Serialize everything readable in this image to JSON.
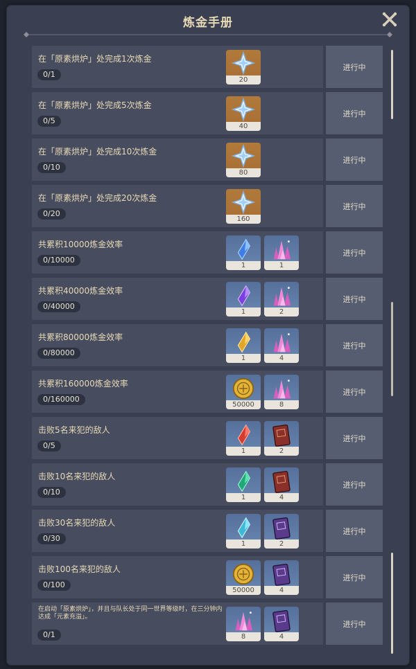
{
  "title": "炼金手册",
  "rows": [
    {
      "text": "在「原素烘炉」处完成1次炼金",
      "progress": "0/1",
      "status": "进行中",
      "rewards": [
        {
          "icon": "primogem-icon",
          "qty": "20",
          "bg": "gold"
        }
      ]
    },
    {
      "text": "在「原素烘炉」处完成5次炼金",
      "progress": "0/5",
      "status": "进行中",
      "rewards": [
        {
          "icon": "primogem-icon",
          "qty": "40",
          "bg": "gold"
        }
      ]
    },
    {
      "text": "在「原素烘炉」处完成10次炼金",
      "progress": "0/10",
      "status": "进行中",
      "rewards": [
        {
          "icon": "primogem-icon",
          "qty": "80",
          "bg": "gold"
        }
      ]
    },
    {
      "text": "在「原素烘炉」处完成20次炼金",
      "progress": "0/20",
      "status": "进行中",
      "rewards": [
        {
          "icon": "primogem-icon",
          "qty": "160",
          "bg": "gold"
        }
      ]
    },
    {
      "text": "共累积10000炼金效率",
      "progress": "0/10000",
      "status": "进行中",
      "rewards": [
        {
          "icon": "blue-gem-icon",
          "qty": "1",
          "bg": "blue"
        },
        {
          "icon": "pink-crystal-icon",
          "qty": "1",
          "bg": "blue"
        }
      ]
    },
    {
      "text": "共累积40000炼金效率",
      "progress": "0/40000",
      "status": "进行中",
      "rewards": [
        {
          "icon": "purple-gem-icon",
          "qty": "1",
          "bg": "blue"
        },
        {
          "icon": "pink-crystal-icon",
          "qty": "2",
          "bg": "blue"
        }
      ]
    },
    {
      "text": "共累积80000炼金效率",
      "progress": "0/80000",
      "status": "进行中",
      "rewards": [
        {
          "icon": "yellow-gem-icon",
          "qty": "1",
          "bg": "blue"
        },
        {
          "icon": "pink-crystal-icon",
          "qty": "4",
          "bg": "blue"
        }
      ]
    },
    {
      "text": "共累积160000炼金效率",
      "progress": "0/160000",
      "status": "进行中",
      "rewards": [
        {
          "icon": "mora-coin-icon",
          "qty": "50000",
          "bg": "blue"
        },
        {
          "icon": "pink-crystal-icon",
          "qty": "8",
          "bg": "blue"
        }
      ]
    },
    {
      "text": "击败5名来犯的敌人",
      "progress": "0/5",
      "status": "进行中",
      "rewards": [
        {
          "icon": "red-gem-icon",
          "qty": "1",
          "bg": "blue"
        },
        {
          "icon": "red-book-icon",
          "qty": "2",
          "bg": "blue"
        }
      ]
    },
    {
      "text": "击败10名来犯的敌人",
      "progress": "0/10",
      "status": "进行中",
      "rewards": [
        {
          "icon": "green-gem-icon",
          "qty": "1",
          "bg": "blue"
        },
        {
          "icon": "red-book-icon",
          "qty": "4",
          "bg": "blue"
        }
      ]
    },
    {
      "text": "击败30名来犯的敌人",
      "progress": "0/30",
      "status": "进行中",
      "rewards": [
        {
          "icon": "cyan-gem-icon",
          "qty": "1",
          "bg": "blue"
        },
        {
          "icon": "purple-book-icon",
          "qty": "2",
          "bg": "blue"
        }
      ]
    },
    {
      "text": "击败100名来犯的敌人",
      "progress": "0/100",
      "status": "进行中",
      "rewards": [
        {
          "icon": "mora-coin-icon",
          "qty": "50000",
          "bg": "blue"
        },
        {
          "icon": "purple-book-icon",
          "qty": "4",
          "bg": "blue"
        }
      ]
    },
    {
      "text": "在启动「原素烘炉」，并且与队长处于同一世界等级时，在三分钟内达成「元素充溢」。",
      "progress": "0/1",
      "status": "进行中",
      "rewards": [
        {
          "icon": "pink-crystal-icon",
          "qty": "8",
          "bg": "blue"
        },
        {
          "icon": "purple-book-icon",
          "qty": "4",
          "bg": "blue"
        }
      ]
    }
  ],
  "colors": {
    "panel": "#3a4051",
    "row": "#474d5f",
    "action": "#565d70",
    "title": "#e8d9b6"
  }
}
